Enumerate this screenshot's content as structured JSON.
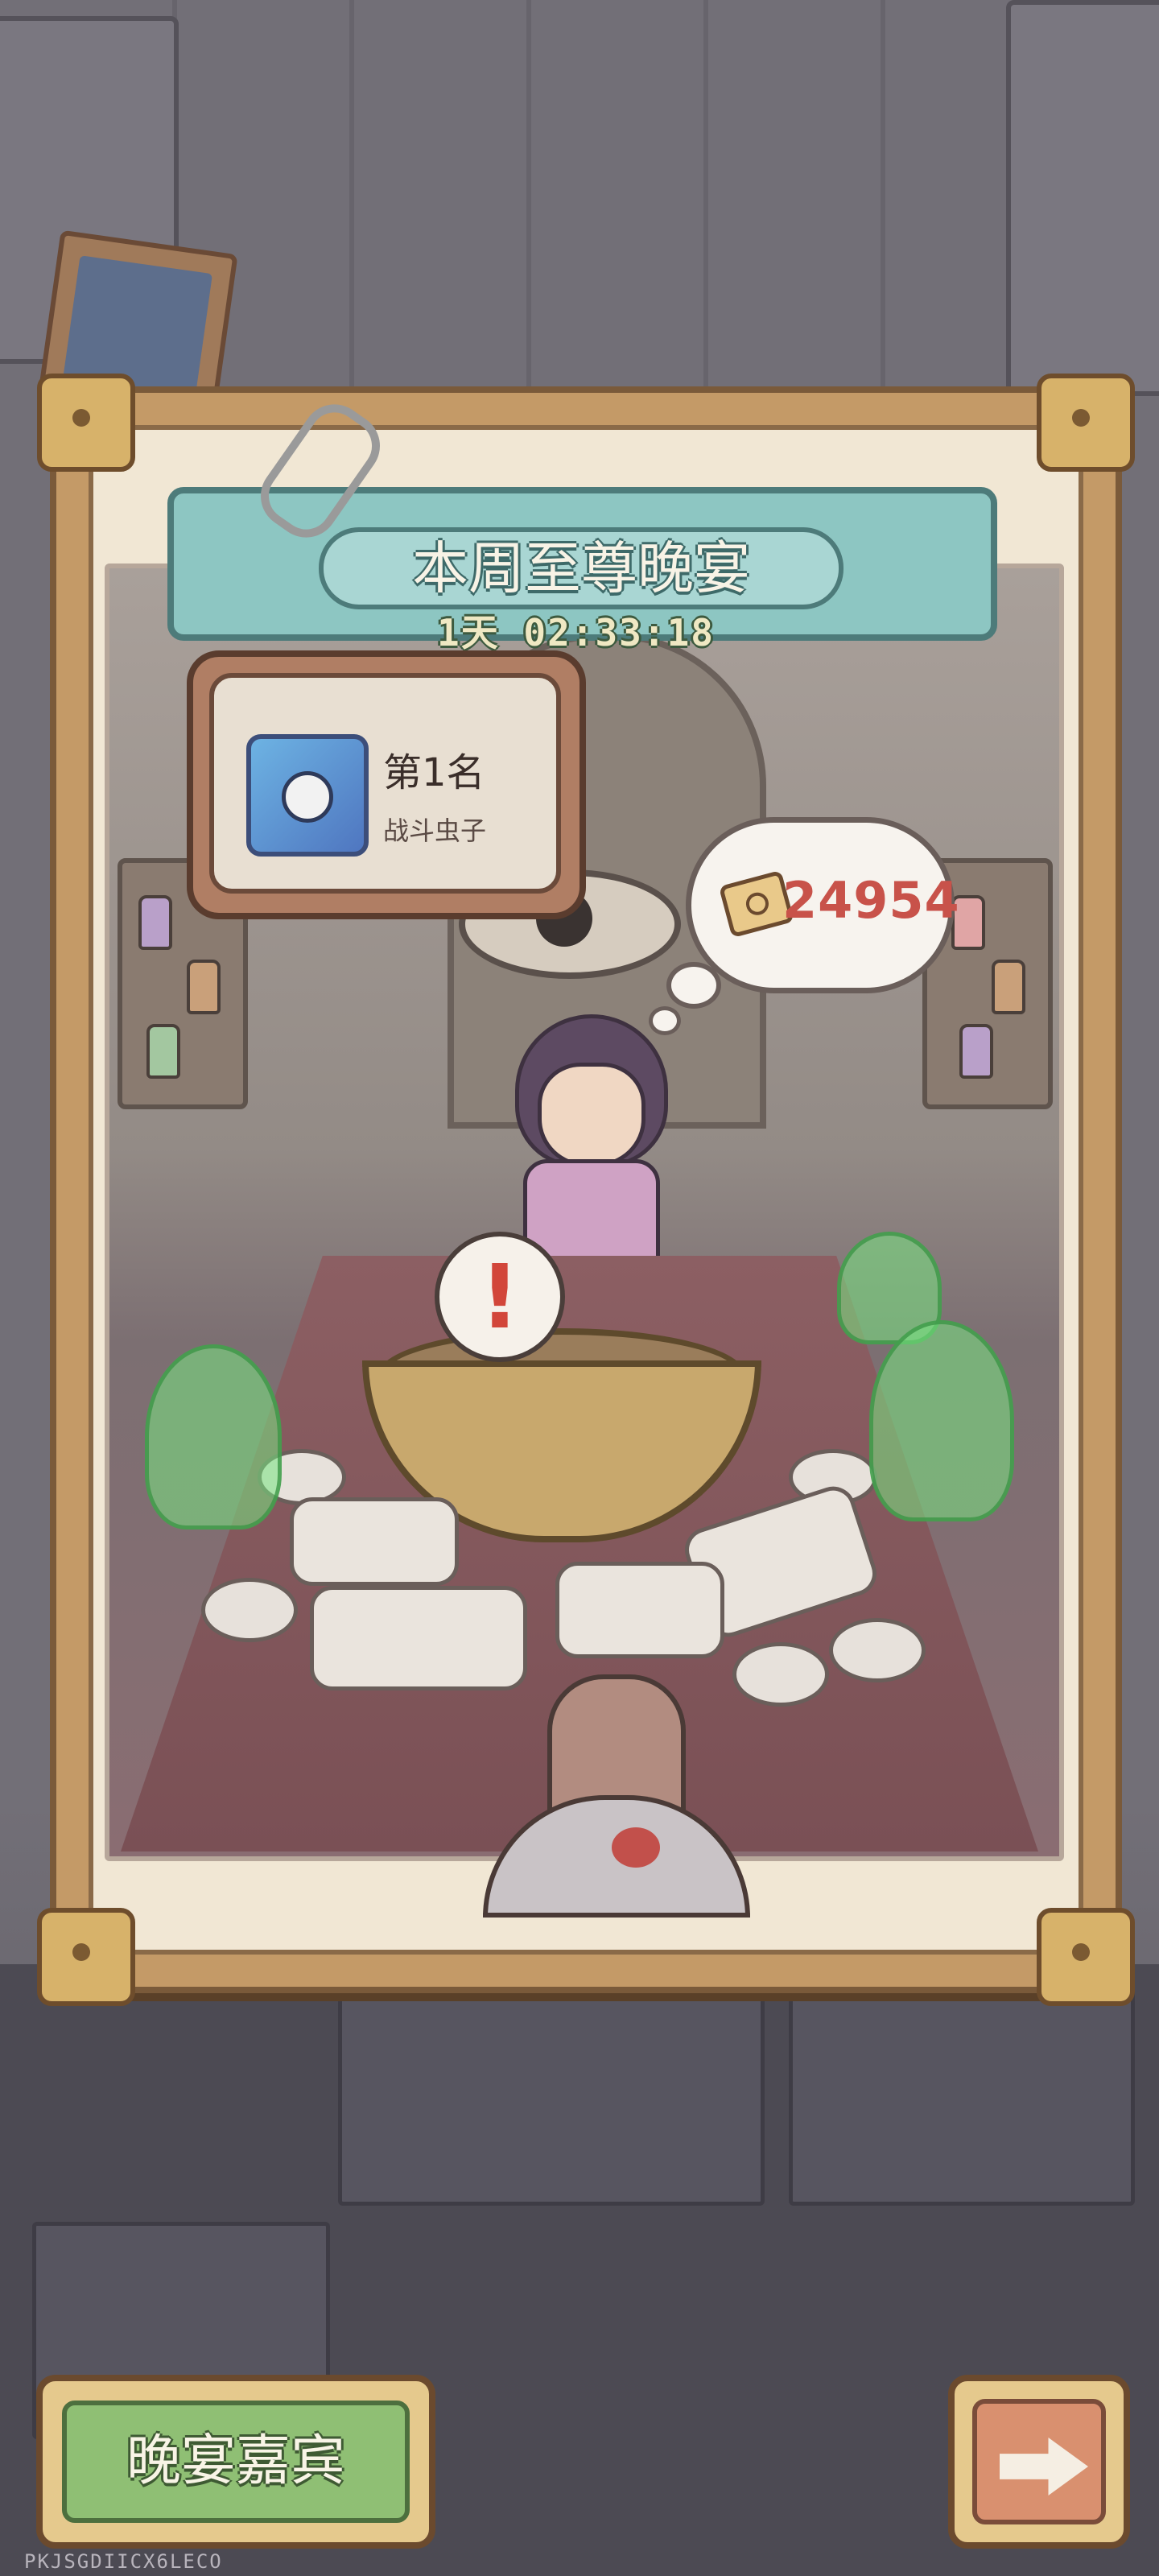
{
  "banquet": {
    "title": "本周至尊晚宴",
    "countdown": "1天 02:33:18"
  },
  "rank": {
    "label": "第1名",
    "player_name": "战斗虫子"
  },
  "points": {
    "value": "24954",
    "icon": "ticket-icon"
  },
  "alert": {
    "symbol": "!"
  },
  "buttons": {
    "guests_label": "晚宴嘉宾",
    "next_icon": "arrow-right-icon"
  },
  "watermark": "PKJSGDIICX6LECO",
  "colors": {
    "banner": "#8dc6c2",
    "points_text": "#c8524a",
    "guests_button": "#8fbf74",
    "next_button": "#d9906f"
  }
}
